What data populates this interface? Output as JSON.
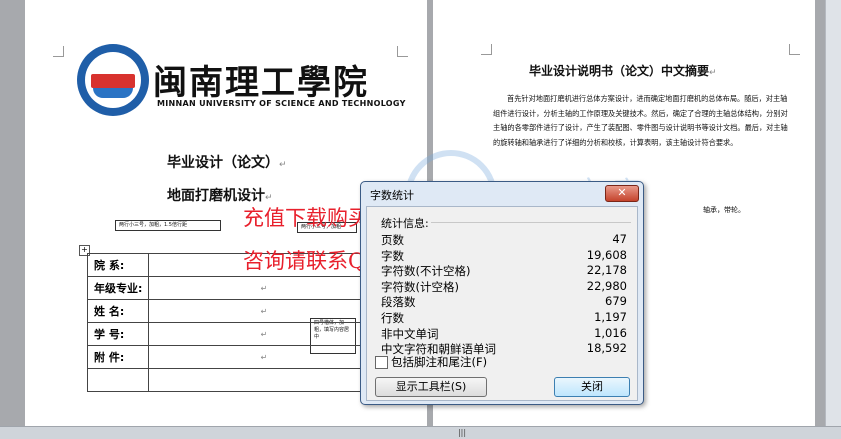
{
  "left_page": {
    "logo_cn": "闽南理工學院",
    "logo_en": "MINNAN UNIVERSITY OF SCIENCE AND TECHNOLOGY",
    "title1": "毕业设计（论文）",
    "title2": "地面打磨机设计",
    "para_mark": "↵",
    "note1": "两行小三号，加粗，1.5倍行距",
    "note2": "两行小三号，加粗",
    "note3": "四号楷体，加粗，填写内容居中",
    "table": {
      "rows": [
        {
          "label": "院  系:",
          "value": ""
        },
        {
          "label": "年级专业:",
          "value": "↵"
        },
        {
          "label": "姓  名:",
          "value": "↵"
        },
        {
          "label": "学  号:",
          "value": "↵"
        },
        {
          "label": "附  件:",
          "value": "↵"
        },
        {
          "label": "",
          "value": ""
        }
      ]
    }
  },
  "right_page": {
    "title": "毕业设计说明书（论文）中文摘要",
    "body": "首先针对地面打磨机进行总体方案设计，进而确定地面打磨机的总体布局。随后，对主轴组件进行设计，分析主轴的工作原理及关键技术。然后，确定了合理的主轴总体结构，分别对主轴的各零部件进行了设计，产生了装配图、零件图与设计说明书等设计文档。最后，对主轴的旋转轴和轴承进行了详细的分析和校核，计算表明，该主轴设计符合要求。",
    "fragment": "轴承，带轮。"
  },
  "watermark": {
    "line1": "充值下载购买全套图纸+Word文档",
    "line2": "咨询请联系QQ 401339828",
    "color": "#e8202c"
  },
  "dialog": {
    "title": "字数统计",
    "close_glyph": "✕",
    "section_label": "统计信息:",
    "stats": [
      {
        "key": "页数",
        "value": "47"
      },
      {
        "key": "字数",
        "value": "19,608"
      },
      {
        "key": "字符数(不计空格)",
        "value": "22,178"
      },
      {
        "key": "字符数(计空格)",
        "value": "22,980"
      },
      {
        "key": "段落数",
        "value": "679"
      },
      {
        "key": "行数",
        "value": "1,197"
      },
      {
        "key": "非中文单词",
        "value": "1,016"
      },
      {
        "key": "中文字符和朝鲜语单词",
        "value": "18,592"
      }
    ],
    "checkbox_label": "包括脚注和尾注(F)",
    "checkbox_checked": false,
    "show_toolbar_button": "显示工具栏(S)",
    "close_button": "关闭"
  },
  "status": {
    "splitter_glyph": "|||"
  }
}
